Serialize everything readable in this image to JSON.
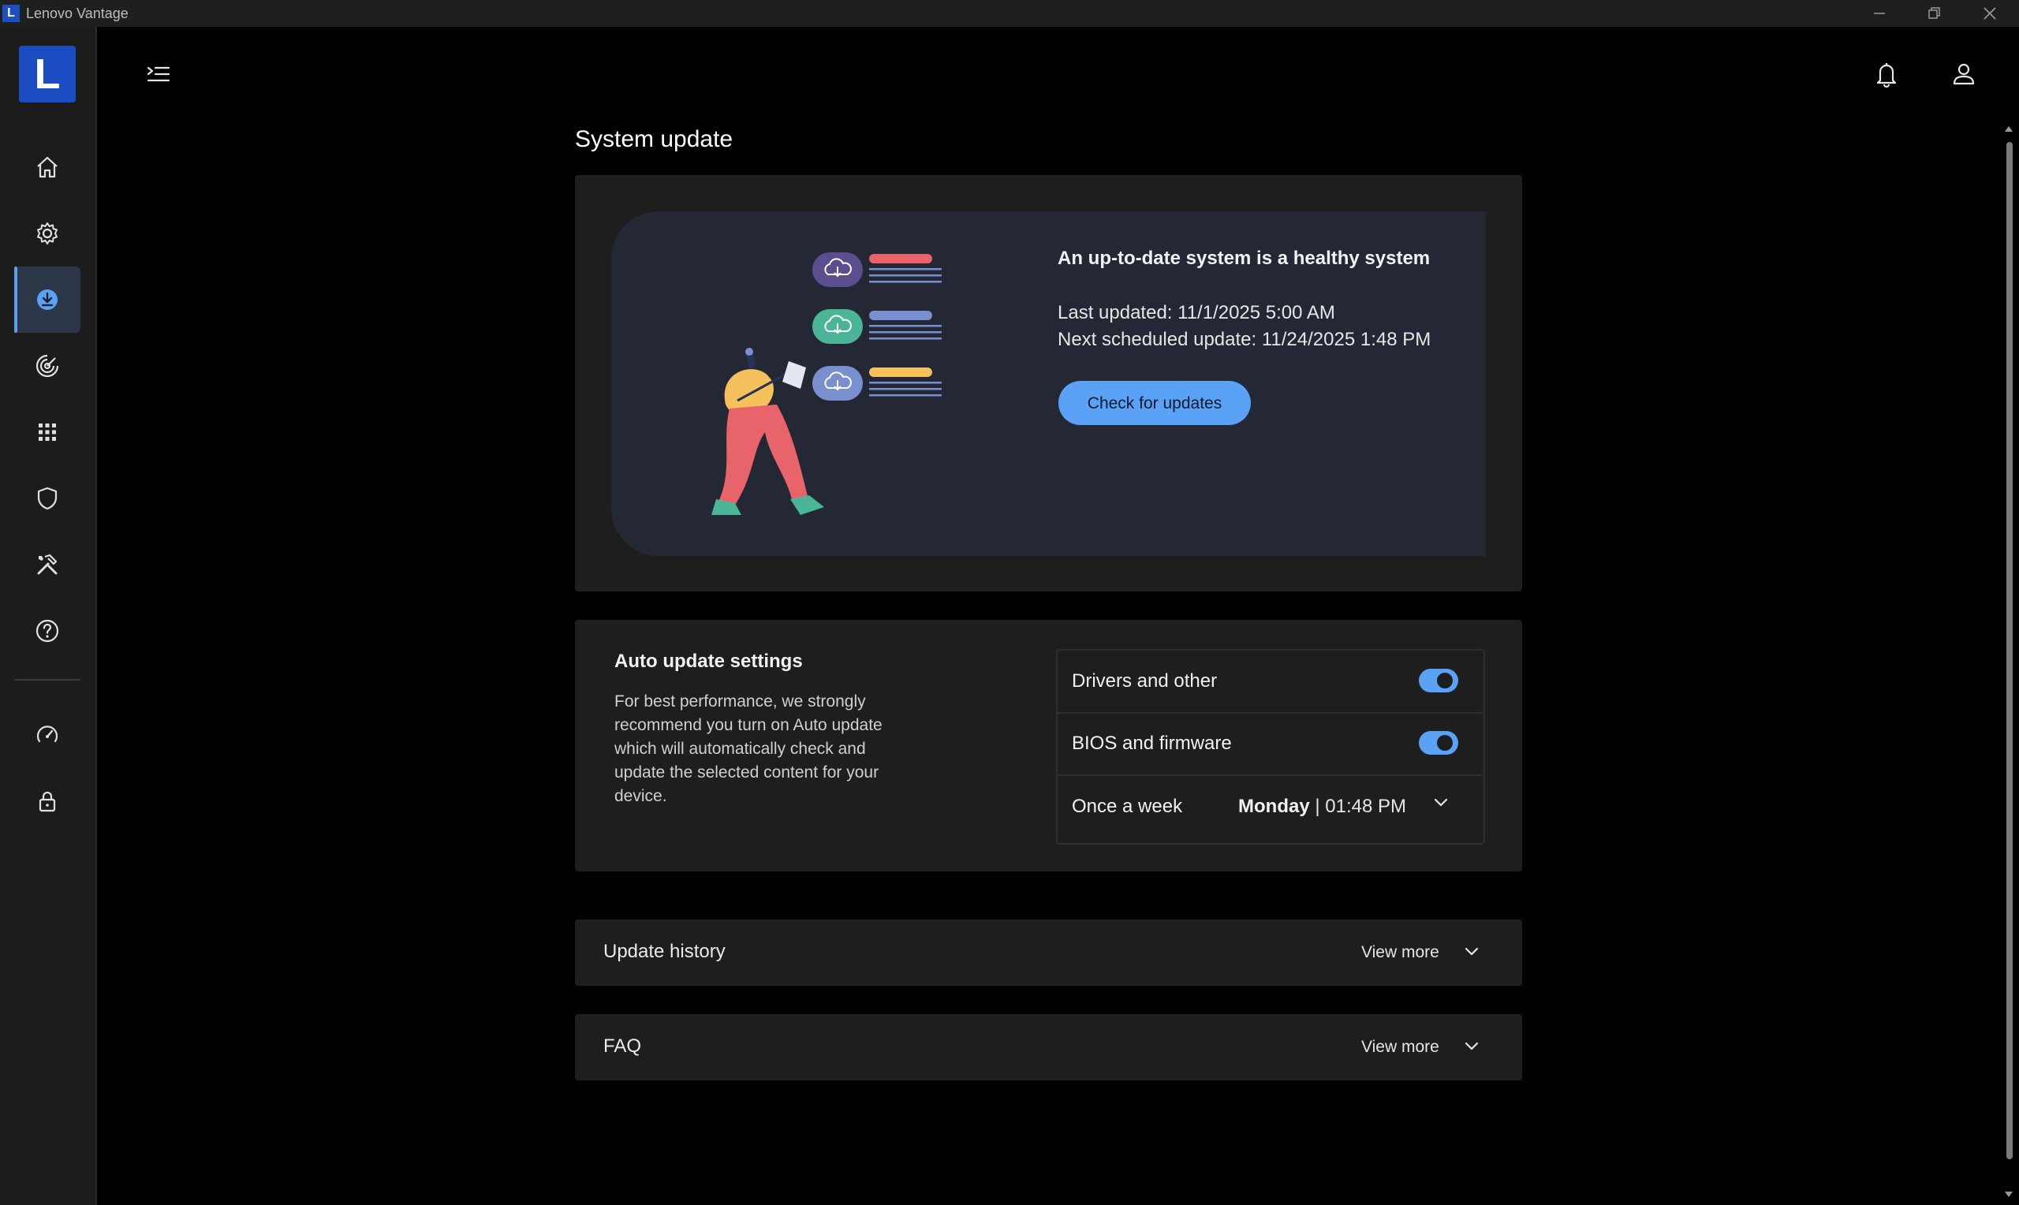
{
  "window": {
    "title": "Lenovo Vantage",
    "logo_letter": "L"
  },
  "sidebar": {
    "logo_letter": "L",
    "items": [
      {
        "name": "home",
        "icon": "home-icon"
      },
      {
        "name": "settings",
        "icon": "gear-icon"
      },
      {
        "name": "system-update",
        "icon": "download-icon",
        "active": true
      },
      {
        "name": "smart-features",
        "icon": "radar-icon"
      },
      {
        "name": "apps",
        "icon": "grid-icon"
      },
      {
        "name": "security",
        "icon": "shield-icon"
      },
      {
        "name": "tools",
        "icon": "tools-icon"
      },
      {
        "name": "help",
        "icon": "help-icon"
      },
      {
        "name": "performance",
        "icon": "speedometer-icon"
      },
      {
        "name": "privacy",
        "icon": "lock-icon"
      }
    ]
  },
  "header": {
    "menu_icon": "menu-collapse-icon",
    "bell_icon": "bell-icon",
    "user_icon": "user-icon"
  },
  "main": {
    "title": "System update",
    "hero": {
      "heading": "An up-to-date system is a healthy system",
      "last_updated": "Last updated: 11/1/2025 5:00 AM",
      "next_update": "Next scheduled update: 11/24/2025 1:48 PM",
      "check_button": "Check for updates"
    },
    "auto_update": {
      "title": "Auto update settings",
      "description": "For best performance, we strongly recommend you turn on Auto update which will automatically check and update the selected content for your device.",
      "options": [
        {
          "label": "Drivers and other",
          "enabled": true
        },
        {
          "label": "BIOS and firmware",
          "enabled": true
        }
      ],
      "frequency_label": "Once a week",
      "schedule_day": "Monday",
      "schedule_separator": " | ",
      "schedule_time": "01:48 PM"
    },
    "sections": [
      {
        "title": "Update history",
        "action": "View more"
      },
      {
        "title": "FAQ",
        "action": "View more"
      }
    ]
  },
  "colors": {
    "accent": "#5aa2f5",
    "brand": "#1b4cc2",
    "card": "#1e1e1f",
    "hero_bg": "#232834"
  }
}
